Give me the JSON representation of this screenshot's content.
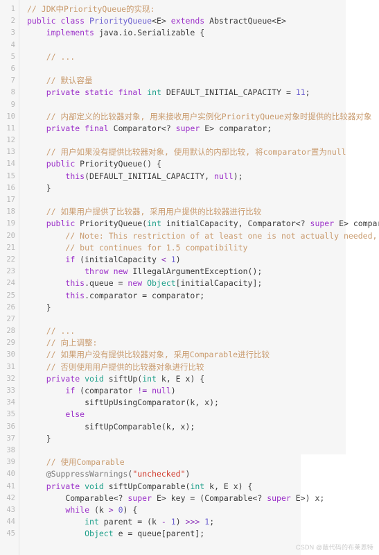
{
  "editor": {
    "language": "java",
    "background_color": "#f6f6f6",
    "gutter_color": "#f6f6f6",
    "line_number_color": "#b7b7b7",
    "text_color": "#3a3a3a",
    "first_line_number": 1,
    "last_line_number": 45,
    "token_colors": {
      "comment": "#c99b6e",
      "keyword": "#9b30c9",
      "class_name": "#6b5fd0",
      "primitive_type": "#1fa08a",
      "number": "#6b5fd0",
      "string": "#d0392b",
      "annotation": "#7a7a7a",
      "operator": "#8a2fb8",
      "plain": "#3a3a3a"
    }
  },
  "watermark": {
    "text": "CSDN @敲代码的布莱恩特"
  },
  "lines": [
    {
      "n": "1",
      "tokens": [
        {
          "t": "com",
          "s": "// JDK中PriorityQueue的实现:"
        }
      ]
    },
    {
      "n": "2",
      "tokens": [
        {
          "t": "key",
          "s": "public"
        },
        {
          "t": "pln",
          "s": " "
        },
        {
          "t": "key",
          "s": "class"
        },
        {
          "t": "pln",
          "s": " "
        },
        {
          "t": "cls",
          "s": "PriorityQueue"
        },
        {
          "t": "pln",
          "s": "<E> "
        },
        {
          "t": "key",
          "s": "extends"
        },
        {
          "t": "pln",
          "s": " AbstractQueue<E>"
        }
      ]
    },
    {
      "n": "3",
      "tokens": [
        {
          "t": "pln",
          "s": "    "
        },
        {
          "t": "key",
          "s": "implements"
        },
        {
          "t": "pln",
          "s": " java.io.Serializable {"
        }
      ]
    },
    {
      "n": "4",
      "tokens": []
    },
    {
      "n": "5",
      "tokens": [
        {
          "t": "com",
          "s": "    // ..."
        }
      ]
    },
    {
      "n": "6",
      "tokens": []
    },
    {
      "n": "7",
      "tokens": [
        {
          "t": "com",
          "s": "    // 默认容量"
        }
      ]
    },
    {
      "n": "8",
      "tokens": [
        {
          "t": "pln",
          "s": "    "
        },
        {
          "t": "key",
          "s": "private"
        },
        {
          "t": "pln",
          "s": " "
        },
        {
          "t": "key",
          "s": "static"
        },
        {
          "t": "pln",
          "s": " "
        },
        {
          "t": "key",
          "s": "final"
        },
        {
          "t": "pln",
          "s": " "
        },
        {
          "t": "type",
          "s": "int"
        },
        {
          "t": "pln",
          "s": " DEFAULT_INITIAL_CAPACITY = "
        },
        {
          "t": "num",
          "s": "11"
        },
        {
          "t": "pln",
          "s": ";"
        }
      ]
    },
    {
      "n": "9",
      "tokens": []
    },
    {
      "n": "10",
      "tokens": [
        {
          "t": "com",
          "s": "    // 内部定义的比较器对象, 用来接收用户实例化PriorityQueue对象时提供的比较器对象"
        }
      ]
    },
    {
      "n": "11",
      "tokens": [
        {
          "t": "pln",
          "s": "    "
        },
        {
          "t": "key",
          "s": "private"
        },
        {
          "t": "pln",
          "s": " "
        },
        {
          "t": "key",
          "s": "final"
        },
        {
          "t": "pln",
          "s": " Comparator<? "
        },
        {
          "t": "key",
          "s": "super"
        },
        {
          "t": "pln",
          "s": " E> comparator;"
        }
      ]
    },
    {
      "n": "12",
      "tokens": []
    },
    {
      "n": "13",
      "tokens": [
        {
          "t": "com",
          "s": "    // 用户如果没有提供比较器对象, 使用默认的内部比较, 将comparator置为null"
        }
      ]
    },
    {
      "n": "14",
      "tokens": [
        {
          "t": "pln",
          "s": "    "
        },
        {
          "t": "key",
          "s": "public"
        },
        {
          "t": "pln",
          "s": " PriorityQueue() {"
        }
      ]
    },
    {
      "n": "15",
      "tokens": [
        {
          "t": "pln",
          "s": "        "
        },
        {
          "t": "key",
          "s": "this"
        },
        {
          "t": "pln",
          "s": "(DEFAULT_INITIAL_CAPACITY, "
        },
        {
          "t": "key",
          "s": "null"
        },
        {
          "t": "pln",
          "s": ");"
        }
      ]
    },
    {
      "n": "16",
      "tokens": [
        {
          "t": "pln",
          "s": "    }"
        }
      ]
    },
    {
      "n": "17",
      "tokens": []
    },
    {
      "n": "18",
      "tokens": [
        {
          "t": "com",
          "s": "    // 如果用户提供了比较器, 采用用户提供的比较器进行比较"
        }
      ]
    },
    {
      "n": "19",
      "tokens": [
        {
          "t": "pln",
          "s": "    "
        },
        {
          "t": "key",
          "s": "public"
        },
        {
          "t": "pln",
          "s": " PriorityQueue("
        },
        {
          "t": "type",
          "s": "int"
        },
        {
          "t": "pln",
          "s": " initialCapacity, Comparator<? "
        },
        {
          "t": "key",
          "s": "super"
        },
        {
          "t": "pln",
          "s": " E> comparator) {"
        }
      ]
    },
    {
      "n": "20",
      "tokens": [
        {
          "t": "com",
          "s": "        // Note: This restriction of at least one is not actually needed,"
        }
      ]
    },
    {
      "n": "21",
      "tokens": [
        {
          "t": "com",
          "s": "        // but continues for 1.5 compatibility"
        }
      ]
    },
    {
      "n": "22",
      "tokens": [
        {
          "t": "pln",
          "s": "        "
        },
        {
          "t": "key",
          "s": "if"
        },
        {
          "t": "pln",
          "s": " (initialCapacity "
        },
        {
          "t": "op",
          "s": "<"
        },
        {
          "t": "pln",
          "s": " "
        },
        {
          "t": "num",
          "s": "1"
        },
        {
          "t": "pln",
          "s": ")"
        }
      ]
    },
    {
      "n": "23",
      "tokens": [
        {
          "t": "pln",
          "s": "            "
        },
        {
          "t": "key",
          "s": "throw"
        },
        {
          "t": "pln",
          "s": " "
        },
        {
          "t": "key",
          "s": "new"
        },
        {
          "t": "pln",
          "s": " IllegalArgumentException();"
        }
      ]
    },
    {
      "n": "24",
      "tokens": [
        {
          "t": "pln",
          "s": "        "
        },
        {
          "t": "key",
          "s": "this"
        },
        {
          "t": "pln",
          "s": ".queue = "
        },
        {
          "t": "key",
          "s": "new"
        },
        {
          "t": "pln",
          "s": " "
        },
        {
          "t": "type",
          "s": "Object"
        },
        {
          "t": "pln",
          "s": "[initialCapacity];"
        }
      ]
    },
    {
      "n": "25",
      "tokens": [
        {
          "t": "pln",
          "s": "        "
        },
        {
          "t": "key",
          "s": "this"
        },
        {
          "t": "pln",
          "s": ".comparator = comparator;"
        }
      ]
    },
    {
      "n": "26",
      "tokens": [
        {
          "t": "pln",
          "s": "    }"
        }
      ]
    },
    {
      "n": "27",
      "tokens": []
    },
    {
      "n": "28",
      "tokens": [
        {
          "t": "com",
          "s": "    // ..."
        }
      ]
    },
    {
      "n": "29",
      "tokens": [
        {
          "t": "com",
          "s": "    // 向上调整:"
        }
      ]
    },
    {
      "n": "30",
      "tokens": [
        {
          "t": "com",
          "s": "    // 如果用户没有提供比较器对象, 采用Comparable进行比较"
        }
      ]
    },
    {
      "n": "31",
      "tokens": [
        {
          "t": "com",
          "s": "    // 否则使用用户提供的比较器对象进行比较"
        }
      ]
    },
    {
      "n": "32",
      "tokens": [
        {
          "t": "pln",
          "s": "    "
        },
        {
          "t": "key",
          "s": "private"
        },
        {
          "t": "pln",
          "s": " "
        },
        {
          "t": "type",
          "s": "void"
        },
        {
          "t": "pln",
          "s": " siftUp("
        },
        {
          "t": "type",
          "s": "int"
        },
        {
          "t": "pln",
          "s": " k, E x) {"
        }
      ]
    },
    {
      "n": "33",
      "tokens": [
        {
          "t": "pln",
          "s": "        "
        },
        {
          "t": "key",
          "s": "if"
        },
        {
          "t": "pln",
          "s": " (comparator "
        },
        {
          "t": "op",
          "s": "!="
        },
        {
          "t": "pln",
          "s": " "
        },
        {
          "t": "key",
          "s": "null"
        },
        {
          "t": "pln",
          "s": ")"
        }
      ]
    },
    {
      "n": "34",
      "tokens": [
        {
          "t": "pln",
          "s": "            siftUpUsingComparator(k, x);"
        }
      ]
    },
    {
      "n": "35",
      "tokens": [
        {
          "t": "pln",
          "s": "        "
        },
        {
          "t": "key",
          "s": "else"
        }
      ]
    },
    {
      "n": "36",
      "tokens": [
        {
          "t": "pln",
          "s": "            siftUpComparable(k, x);"
        }
      ]
    },
    {
      "n": "37",
      "tokens": [
        {
          "t": "pln",
          "s": "    }"
        }
      ]
    },
    {
      "n": "38",
      "tokens": []
    },
    {
      "n": "39",
      "tokens": [
        {
          "t": "com",
          "s": "    // 使用Comparable"
        }
      ]
    },
    {
      "n": "40",
      "tokens": [
        {
          "t": "pln",
          "s": "    "
        },
        {
          "t": "ann",
          "s": "@SuppressWarnings"
        },
        {
          "t": "pln",
          "s": "("
        },
        {
          "t": "str",
          "s": "\"unchecked\""
        },
        {
          "t": "pln",
          "s": ")"
        }
      ]
    },
    {
      "n": "41",
      "tokens": [
        {
          "t": "pln",
          "s": "    "
        },
        {
          "t": "key",
          "s": "private"
        },
        {
          "t": "pln",
          "s": " "
        },
        {
          "t": "type",
          "s": "void"
        },
        {
          "t": "pln",
          "s": " siftUpComparable("
        },
        {
          "t": "type",
          "s": "int"
        },
        {
          "t": "pln",
          "s": " k, E x) {"
        }
      ]
    },
    {
      "n": "42",
      "tokens": [
        {
          "t": "pln",
          "s": "        Comparable<? "
        },
        {
          "t": "key",
          "s": "super"
        },
        {
          "t": "pln",
          "s": " E> key = (Comparable<? "
        },
        {
          "t": "key",
          "s": "super"
        },
        {
          "t": "pln",
          "s": " E>) x;"
        }
      ]
    },
    {
      "n": "43",
      "tokens": [
        {
          "t": "pln",
          "s": "        "
        },
        {
          "t": "key",
          "s": "while"
        },
        {
          "t": "pln",
          "s": " (k "
        },
        {
          "t": "op",
          "s": ">"
        },
        {
          "t": "pln",
          "s": " "
        },
        {
          "t": "num",
          "s": "0"
        },
        {
          "t": "pln",
          "s": ") {"
        }
      ]
    },
    {
      "n": "44",
      "tokens": [
        {
          "t": "pln",
          "s": "            "
        },
        {
          "t": "type",
          "s": "int"
        },
        {
          "t": "pln",
          "s": " parent = (k "
        },
        {
          "t": "op",
          "s": "-"
        },
        {
          "t": "pln",
          "s": " "
        },
        {
          "t": "num",
          "s": "1"
        },
        {
          "t": "pln",
          "s": ") "
        },
        {
          "t": "op",
          "s": ">>>"
        },
        {
          "t": "pln",
          "s": " "
        },
        {
          "t": "num",
          "s": "1"
        },
        {
          "t": "pln",
          "s": ";"
        }
      ]
    },
    {
      "n": "45",
      "tokens": [
        {
          "t": "pln",
          "s": "            "
        },
        {
          "t": "type",
          "s": "Object"
        },
        {
          "t": "pln",
          "s": " e = queue[parent];"
        }
      ]
    }
  ]
}
